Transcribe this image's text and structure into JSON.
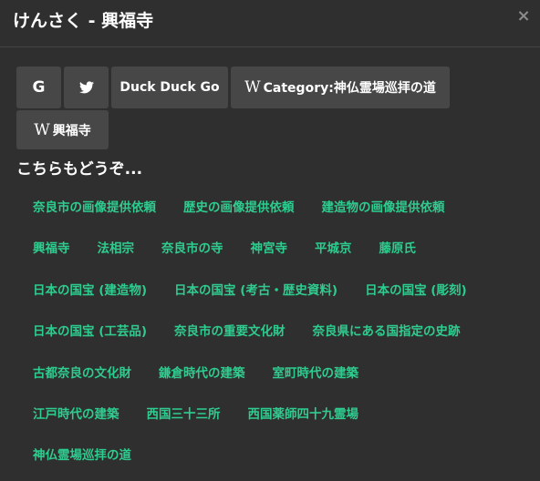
{
  "window": {
    "title": "けんさく - 興福寺",
    "close_label": "×"
  },
  "buttons": [
    {
      "label": "G",
      "icon": "google-icon"
    },
    {
      "label": "",
      "icon": "twitter-bird-icon"
    },
    {
      "label": "Duck Duck Go"
    },
    {
      "label": "Category:神仏霊場巡拝の道",
      "icon": "wikipedia-icon",
      "icon_glyph": "W"
    },
    {
      "label": "興福寺",
      "icon": "wikipedia-icon",
      "icon_glyph": "W"
    }
  ],
  "related": {
    "title": "こちらもどうぞ...",
    "rows": [
      [
        "奈良市の画像提供依頼",
        "歴史の画像提供依頼",
        "建造物の画像提供依頼"
      ],
      [
        "興福寺",
        "法相宗",
        "奈良市の寺",
        "神宮寺",
        "平城京",
        "藤原氏"
      ],
      [
        "日本の国宝 (建造物)",
        "日本の国宝 (考古・歴史資料)",
        "日本の国宝 (彫刻)"
      ],
      [
        "日本の国宝 (工芸品)",
        "奈良市の重要文化財",
        "奈良県にある国指定の史跡"
      ],
      [
        "古都奈良の文化財",
        "鎌倉時代の建築",
        "室町時代の建築"
      ],
      [
        "江戸時代の建築",
        "西国三十三所",
        "西国薬師四十九霊場"
      ],
      [
        "神仏霊場巡拝の道"
      ]
    ]
  },
  "colors": {
    "background": "#2f2f2f",
    "button": "#474747",
    "link": "#2ecc8f"
  }
}
